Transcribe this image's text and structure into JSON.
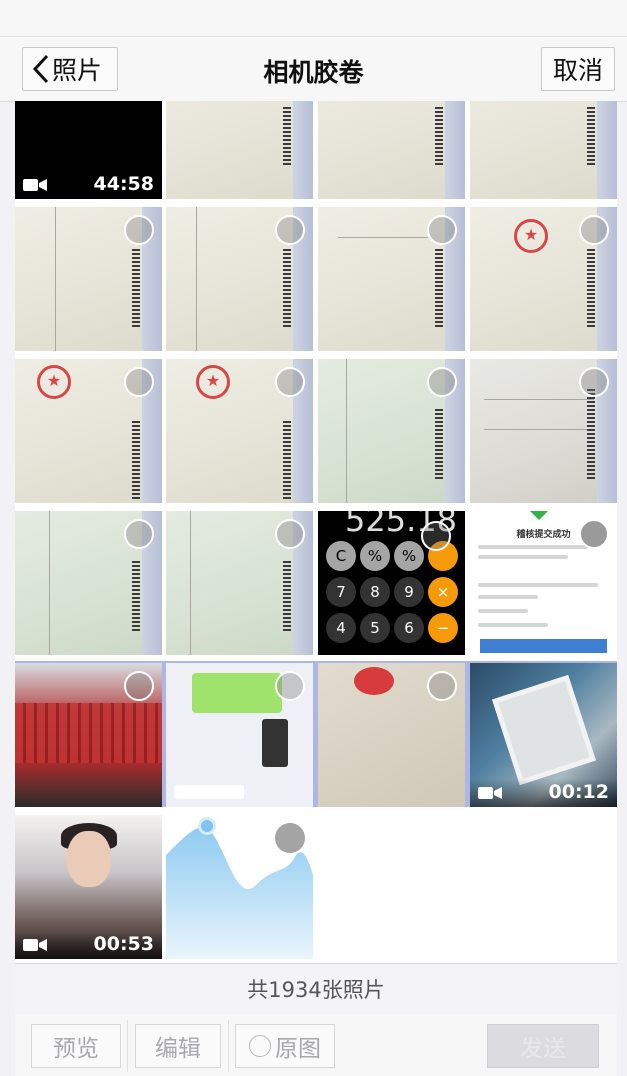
{
  "nav": {
    "back_label": "照片",
    "title": "相机胶卷",
    "cancel_label": "取消"
  },
  "grid": {
    "videos": {
      "first": "44:58",
      "desk": "00:12",
      "selfie": "00:53"
    },
    "calculator": {
      "display": "525.18",
      "keys": [
        "C",
        "%",
        "%",
        "7",
        "8",
        "9",
        "×",
        "4",
        "5",
        "6",
        "−"
      ]
    },
    "success_page": {
      "title": "稽核提交成功"
    }
  },
  "footer": {
    "count_text": "共1934张照片"
  },
  "toolbar": {
    "preview_label": "预览",
    "edit_label": "编辑",
    "original_label": "原图",
    "send_label": "发送"
  },
  "colors": {
    "selected_row": "#aeb6e6",
    "accent_orange": "#f69a0a",
    "stamp_red": "#d8464a"
  }
}
